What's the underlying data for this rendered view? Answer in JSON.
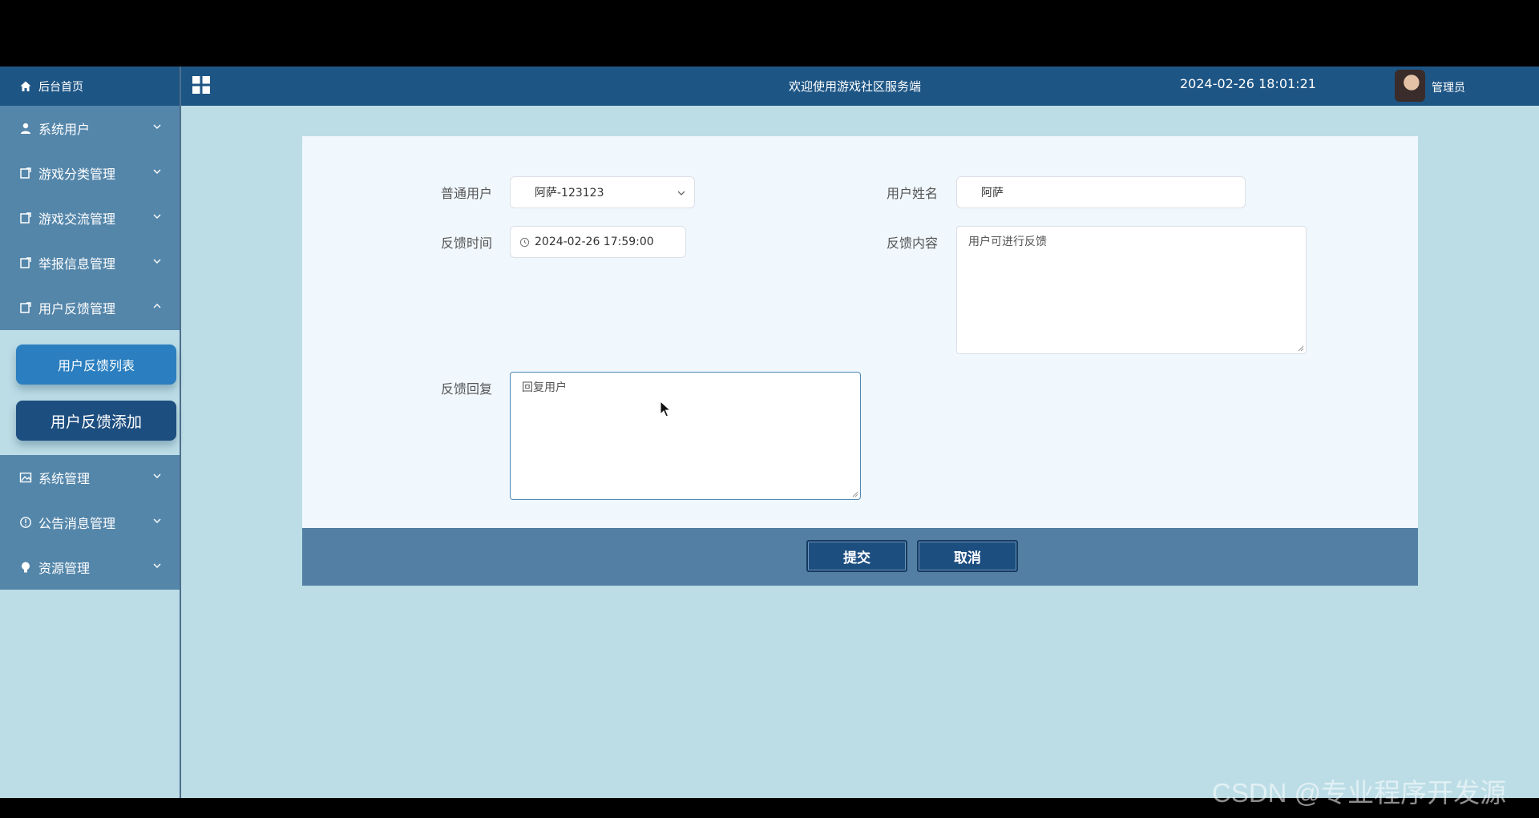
{
  "sidebar": {
    "home": {
      "label": "后台首页",
      "icon": "home-icon"
    },
    "items": [
      {
        "label": "系统用户",
        "icon": "user-icon",
        "expanded": false
      },
      {
        "label": "游戏分类管理",
        "icon": "edit-box-icon",
        "expanded": false
      },
      {
        "label": "游戏交流管理",
        "icon": "edit-box-icon",
        "expanded": false
      },
      {
        "label": "举报信息管理",
        "icon": "edit-box-icon",
        "expanded": false
      },
      {
        "label": "用户反馈管理",
        "icon": "edit-box-icon",
        "expanded": true
      },
      {
        "label": "系统管理",
        "icon": "picture-icon",
        "expanded": false
      },
      {
        "label": "公告消息管理",
        "icon": "info-icon",
        "expanded": false
      },
      {
        "label": "资源管理",
        "icon": "bulb-icon",
        "expanded": false
      }
    ],
    "submenu": {
      "list": "用户反馈列表",
      "add": "用户反馈添加"
    }
  },
  "topbar": {
    "title": "欢迎使用游戏社区服务端",
    "datetime": "2024-02-26 18:01:21",
    "user": "管理员"
  },
  "form": {
    "user_label": "普通用户",
    "user_value": "阿萨-123123",
    "name_label": "用户姓名",
    "name_value": "阿萨",
    "time_label": "反馈时间",
    "time_value": "2024-02-26 17:59:00",
    "content_label": "反馈内容",
    "content_value": "用户可进行反馈",
    "reply_label": "反馈回复",
    "reply_value": "回复用户"
  },
  "actions": {
    "submit": "提交",
    "cancel": "取消"
  },
  "watermark": "CSDN @专业程序开发源",
  "colors": {
    "nav": "#1d5585",
    "menu": "#5486aa",
    "background": "#bcdde6",
    "panel": "#f0f7fd",
    "footer": "#527fa3"
  }
}
